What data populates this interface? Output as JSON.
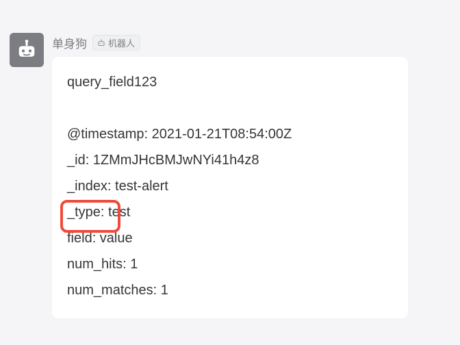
{
  "sender": {
    "name": "单身狗",
    "bot_label": "机器人"
  },
  "message": {
    "title": "query_field123",
    "lines": [
      "@timestamp: 2021-01-21T08:54:00Z",
      "_id: 1ZMmJHcBMJwNYi41h4z8",
      "_index: test-alert",
      "_type: test",
      "field: value",
      "num_hits: 1",
      "num_matches: 1"
    ]
  }
}
